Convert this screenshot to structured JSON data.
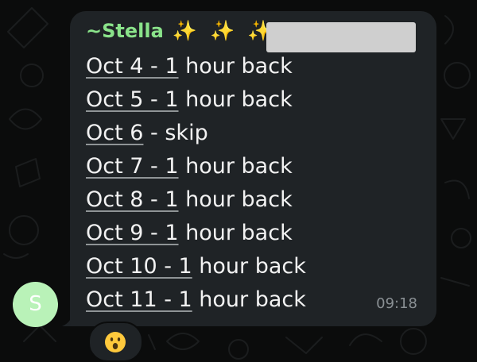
{
  "avatar": {
    "initial": "S",
    "color": "#b9f2b8"
  },
  "message": {
    "sender": "~Stella",
    "sender_emoji": "✨ ✨ ✨",
    "sender_color": "#8ae38a",
    "lines": [
      {
        "date": "Oct 4 - 1",
        "rest": " hour back"
      },
      {
        "date": "Oct 5 - 1",
        "rest": " hour back"
      },
      {
        "date": "Oct 6",
        "rest": " - skip"
      },
      {
        "date": "Oct 7 - 1",
        "rest": " hour back"
      },
      {
        "date": "Oct 8 - 1",
        "rest": " hour back"
      },
      {
        "date": "Oct 9 - 1",
        "rest": " hour back"
      },
      {
        "date": "Oct 10 - 1",
        "rest": " hour back"
      },
      {
        "date": "Oct 11 - 1",
        "rest": " hour back"
      }
    ],
    "time": "09:18",
    "bubble_color": "#1f2326"
  },
  "reaction": {
    "emoji": "face-with-open-mouth-icon"
  }
}
